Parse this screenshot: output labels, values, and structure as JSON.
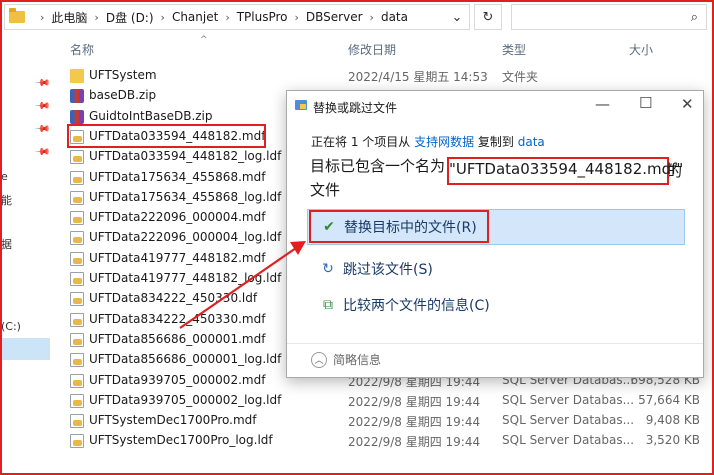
{
  "address": {
    "crumbs": [
      "此电脑",
      "D盘 (D:)",
      "Chanjet",
      "TPlusPro",
      "DBServer",
      "data"
    ],
    "refresh_icon": "refresh-icon",
    "search_icon": "search-icon"
  },
  "nav": {
    "frag1": "e",
    "frag2": "能",
    "frag3": "据",
    "frag4": "(C:)"
  },
  "columns": {
    "name": "名称",
    "date": "修改日期",
    "type": "类型",
    "size": "大小"
  },
  "files": [
    {
      "name": "UFTSystem",
      "date": "2022/4/15 星期五 14:53",
      "type": "文件夹",
      "size": "",
      "icon": "folder-icon"
    },
    {
      "name": "baseDB.zip",
      "date": "",
      "type": "",
      "size": "",
      "icon": "archive-icon"
    },
    {
      "name": "GuidtoIntBaseDB.zip",
      "date": "",
      "type": "",
      "size": "",
      "icon": "archive-icon"
    },
    {
      "name": "UFTData033594_448182.mdf",
      "date": "",
      "type": "",
      "size": "",
      "icon": "database-file-icon"
    },
    {
      "name": "UFTData033594_448182_log.ldf",
      "date": "",
      "type": "",
      "size": "",
      "icon": "database-file-icon"
    },
    {
      "name": "UFTData175634_455868.mdf",
      "date": "",
      "type": "",
      "size": "",
      "icon": "database-file-icon"
    },
    {
      "name": "UFTData175634_455868_log.ldf",
      "date": "",
      "type": "",
      "size": "",
      "icon": "database-file-icon"
    },
    {
      "name": "UFTData222096_000004.mdf",
      "date": "",
      "type": "",
      "size": "",
      "icon": "database-file-icon"
    },
    {
      "name": "UFTData222096_000004_log.ldf",
      "date": "",
      "type": "",
      "size": "",
      "icon": "database-file-icon"
    },
    {
      "name": "UFTData419777_448182.mdf",
      "date": "",
      "type": "",
      "size": "",
      "icon": "database-file-icon"
    },
    {
      "name": "UFTData419777_448182_log.ldf",
      "date": "",
      "type": "",
      "size": "",
      "icon": "database-file-icon"
    },
    {
      "name": "UFTData834222_450330.ldf",
      "date": "",
      "type": "",
      "size": "",
      "icon": "database-file-icon"
    },
    {
      "name": "UFTData834222_450330.mdf",
      "date": "",
      "type": "",
      "size": "",
      "icon": "database-file-icon"
    },
    {
      "name": "UFTData856686_000001.mdf",
      "date": "",
      "type": "",
      "size": "",
      "icon": "database-file-icon"
    },
    {
      "name": "UFTData856686_000001_log.ldf",
      "date": "",
      "type": "",
      "size": "",
      "icon": "database-file-icon"
    },
    {
      "name": "UFTData939705_000002.mdf",
      "date": "2022/9/8 星期四 19:44",
      "type": "SQL Server Databas...",
      "size": "698,528 KB",
      "icon": "database-file-icon"
    },
    {
      "name": "UFTData939705_000002_log.ldf",
      "date": "2022/9/8 星期四 19:44",
      "type": "SQL Server Databas...",
      "size": "57,664 KB",
      "icon": "database-file-icon"
    },
    {
      "name": "UFTSystemDec1700Pro.mdf",
      "date": "2022/9/8 星期四 19:44",
      "type": "SQL Server Databas...",
      "size": "9,408 KB",
      "icon": "database-file-icon"
    },
    {
      "name": "UFTSystemDec1700Pro_log.ldf",
      "date": "2022/9/8 星期四 19:44",
      "type": "SQL Server Databas...",
      "size": "3,520 KB",
      "icon": "database-file-icon"
    }
  ],
  "dialog": {
    "title": "替换或跳过文件",
    "info_prefix": "正在将 1 个项目从 ",
    "info_source": "支持网数据",
    "info_middle": " 复制到 ",
    "info_dest": "data",
    "msg_prefix": "目标已包含一个名为",
    "msg_filename": "\"UFTData033594_448182.mdf\"",
    "msg_suffix": "的",
    "msg_line2": "文件",
    "option_replace": "替换目标中的文件(R)",
    "option_skip": "跳过该文件(S)",
    "option_compare": "比较两个文件的信息(C)",
    "fewer_details": "简略信息"
  },
  "colors": {
    "annotation_red": "#e02020",
    "selection_blue": "#d4e7fa",
    "link_blue": "#0066cc"
  }
}
